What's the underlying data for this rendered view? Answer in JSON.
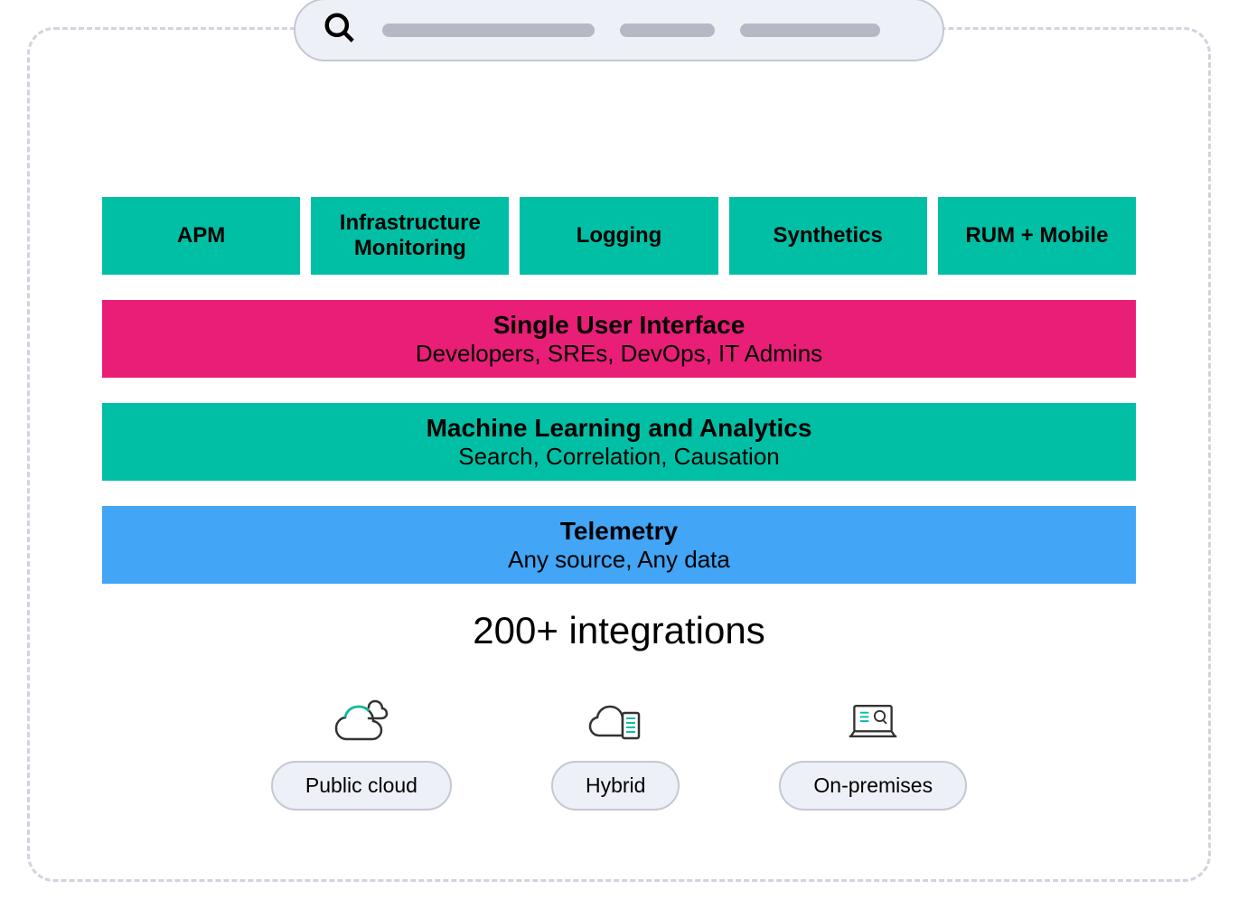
{
  "top_boxes": {
    "apm": "APM",
    "infra": "Infrastructure Monitoring",
    "logging": "Logging",
    "synthetics": "Synthetics",
    "rum": "RUM + Mobile"
  },
  "bars": {
    "ui": {
      "title": "Single User Interface",
      "subtitle": "Developers, SREs, DevOps, IT Admins"
    },
    "ml": {
      "title": "Machine Learning and Analytics",
      "subtitle": "Search, Correlation, Causation"
    },
    "telemetry": {
      "title": "Telemetry",
      "subtitle": "Any source, Any data"
    }
  },
  "integrations": "200+ integrations",
  "deployment": {
    "public_cloud": "Public cloud",
    "hybrid": "Hybrid",
    "on_premises": "On-premises"
  },
  "colors": {
    "teal": "#00BFA5",
    "pink": "#E91E77",
    "blue": "#42A5F5",
    "grey_bg": "#eef0f7",
    "grey_border": "#c2c8d4",
    "skeleton": "#b4b9c5"
  }
}
